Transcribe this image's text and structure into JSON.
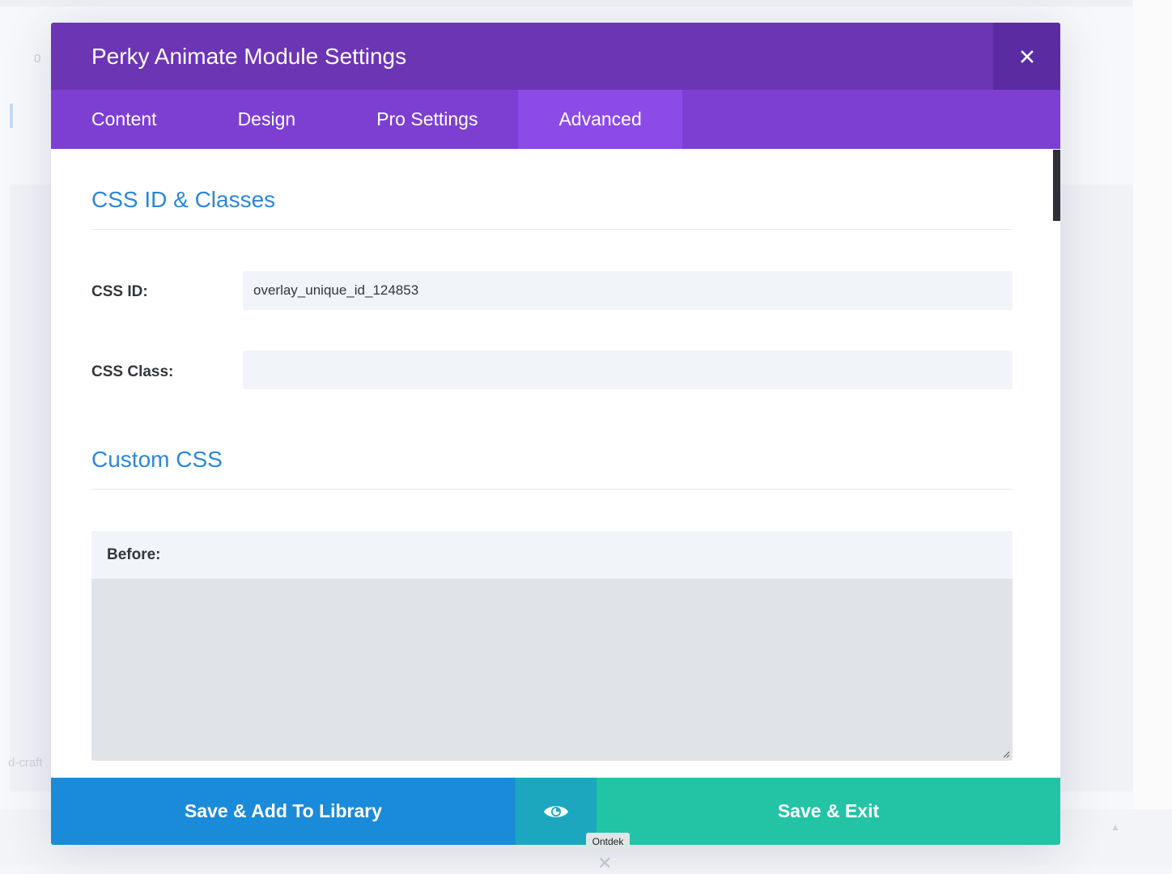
{
  "background": {
    "number": "0",
    "side_text": "d-craft"
  },
  "modal": {
    "title": "Perky Animate Module Settings",
    "tabs": [
      {
        "label": "Content",
        "active": false
      },
      {
        "label": "Design",
        "active": false
      },
      {
        "label": "Pro Settings",
        "active": false
      },
      {
        "label": "Advanced",
        "active": true
      }
    ],
    "sections": {
      "css_id_classes": {
        "title": "CSS ID & Classes",
        "css_id_label": "CSS ID:",
        "css_id_value": "overlay_unique_id_124853",
        "css_class_label": "CSS Class:",
        "css_class_value": ""
      },
      "custom_css": {
        "title": "Custom CSS",
        "before_label": "Before:",
        "before_value": ""
      }
    },
    "footer": {
      "save_library_label": "Save & Add To Library",
      "preview_icon": "eye-icon",
      "save_exit_label": "Save & Exit"
    },
    "tooltip": "Ontdek",
    "icons": {
      "close": "close-icon"
    }
  },
  "colors": {
    "header": "#6c35b4",
    "tabs": "#7d3fd1",
    "active_tab": "#8c4ae6",
    "section_title": "#2b87da",
    "save_library": "#1a8bd9",
    "preview": "#1ca7bf",
    "save_exit": "#23c3a6"
  }
}
